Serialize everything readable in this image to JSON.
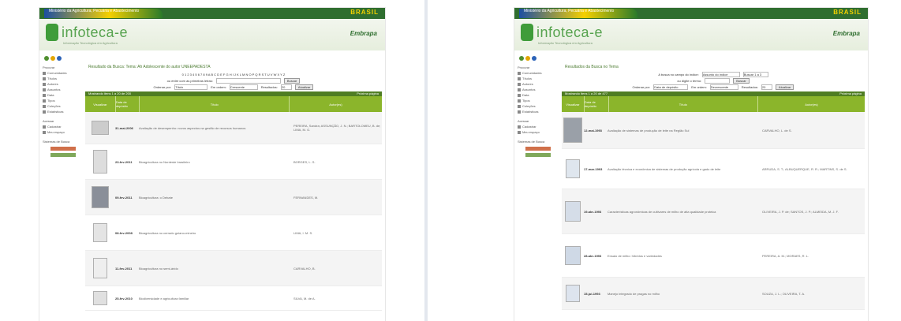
{
  "brand": {
    "gov_text": "Ministério da Agricultura, Pecuária e Abastecimento",
    "brasil": "BRASIL",
    "logo": "infoteca-e",
    "logo_sub": "Informação Tecnológica em Agricultura",
    "embrapa": "Embrapa"
  },
  "panels": [
    {
      "title": "Resultado da Busca: Tema: Ah Adolescente do autor UNEEPADESTA",
      "alphabet": "0 1 2 3 4 5 6 7 8 9 A B C D E F G H I J K L M N O P Q R S T U V W X Y Z",
      "search_label": "ou entre com as primeiras letras:",
      "search_button": "Buscar",
      "sort_label": "Ordenar por:",
      "sort_value": "Título",
      "order_label": "Em ordem:",
      "order_value": "Crescente",
      "results_label": "Resultados:",
      "results_value": "20",
      "update_button": "Atualizar",
      "table_bar_left": "Mostrando itens 1 a 20 de 200",
      "table_bar_right": "Próxima página",
      "columns": [
        "Visualizar",
        "Data de depósito",
        "Título",
        "Autor(es)"
      ],
      "rows": [
        {
          "date": "31-mai-2006",
          "title": "Avaliação de desempenho: novos aspectos na gestão de recursos humanos",
          "author": "PEREIRA, Sandra; ASSUNÇÃO, J. N.; BARTOLOMEU, B. de; LIMA, M. G."
        },
        {
          "date": "23-fev-2011",
          "title": "Bioagricultura no Nordeste brasileiro",
          "author": "BORGES, L. S."
        },
        {
          "date": "09-fev-2011",
          "title": "Bioagricultura: o Debate",
          "author": "FERNANDES, M."
        },
        {
          "date": "08-fev-2008",
          "title": "Bioagricultura no cerrado goiano-mineiro",
          "author": "LIMA, I. M. S."
        },
        {
          "date": "11-fev-2011",
          "title": "Bioagricultura no semi-árido",
          "author": "CARVALHO, B."
        },
        {
          "date": "25-fev-2010",
          "title": "Biodiversidade e agricultura familiar",
          "author": "SILVA, M. de A."
        }
      ]
    },
    {
      "title": "Resultados da Busca no Tema",
      "field1_label": "A busca no campo do índice:",
      "field1_value": "Assunto do índice",
      "field1_btn": "Buscar 1 a 3",
      "field2_label": "ou digite o termo:",
      "search_button": "Buscar",
      "sort_label": "Ordenar por:",
      "sort_value": "Data de depósito",
      "order_label": "Em ordem:",
      "order_value": "Decrescente",
      "results_label": "Resultados:",
      "results_value": "20",
      "update_button": "Atualizar",
      "table_bar_left": "Mostrando itens 1 a 20 de 477",
      "table_bar_right": "Próxima página",
      "columns": [
        "Visualizar",
        "Data de depósito",
        "Título",
        "Autor(es)"
      ],
      "rows": [
        {
          "date": "12-mai-1993",
          "title": "Avaliação de sistemas de produção de leite na Região Sul",
          "author": "CARVALHO, L. de S."
        },
        {
          "date": "17-mar-1993",
          "title": "Avaliação técnica e econômica de sistemas de produção agrícola e gado de leite",
          "author": "ARRUDA, S. T.; ALBUQUERQUE, R. R.; MARTINS, S. de S."
        },
        {
          "date": "19-abr-1993",
          "title": "Características agronômicas de cultivares de milho de alta qualidade proteica",
          "author": "OLIVEIRA, J. P. de; SANTOS, J. P.; ALMEIDA, M. J. F."
        },
        {
          "date": "28-abr-1993",
          "title": "Ensaio de milho: híbridos e variedades",
          "author": "PEREIRA, A. M.; MORAES, R. L."
        },
        {
          "date": "15-jul-1993",
          "title": "Manejo integrado de pragas no milho",
          "author": "SOUZA, J. L.; OLIVEIRA, T. A."
        }
      ]
    }
  ],
  "sidebar": {
    "items": [
      "Procurar",
      "Comunidades",
      "Títulos",
      "Autores",
      "Assuntos",
      "Data",
      "Tipos",
      "Coleções",
      "Estatísticas"
    ],
    "account": [
      "Acessar",
      "Cadastrar",
      "Meu espaço"
    ],
    "apoio": "Sistemas de Busca"
  },
  "colors": {
    "header_green": "#2f6e2f",
    "table_green": "#8bb52b",
    "logo_green": "#57a34f"
  }
}
